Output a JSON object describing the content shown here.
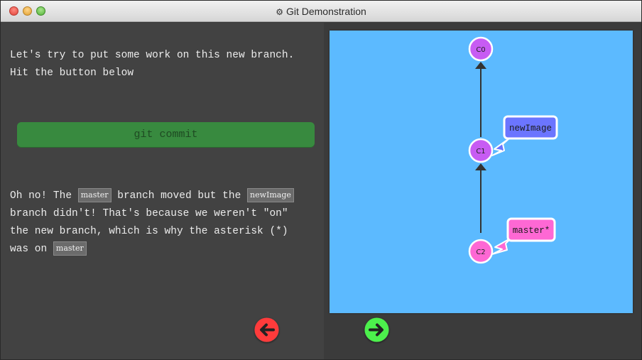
{
  "window": {
    "title": "Git Demonstration",
    "title_icon": "gear-icon"
  },
  "left_panel": {
    "intro": "Let's try to put some work on this new branch. Hit the button below",
    "commit_button": "git commit",
    "result": {
      "s1": "Oh no! The ",
      "tag1": "master",
      "s2": " branch moved but the ",
      "tag2": "newImage",
      "s3": " branch didn't! That's because we weren't \"on\" the new branch, which is why the asterisk (*) was on ",
      "tag3": "master"
    }
  },
  "graph": {
    "commits": [
      "C0",
      "C1",
      "C2"
    ],
    "branches": [
      {
        "label": "newImage",
        "target": "C1"
      },
      {
        "label": "master*",
        "target": "C2"
      }
    ]
  },
  "nav": {
    "prev_icon": "arrow-left-icon",
    "next_icon": "arrow-right-icon"
  },
  "colors": {
    "commit": "#c75cf3",
    "newImage": "#6b75ff",
    "master": "#fe68d4",
    "canvas": "#5cbaff",
    "prev": "#ff3b3b",
    "next": "#4cf04c"
  }
}
